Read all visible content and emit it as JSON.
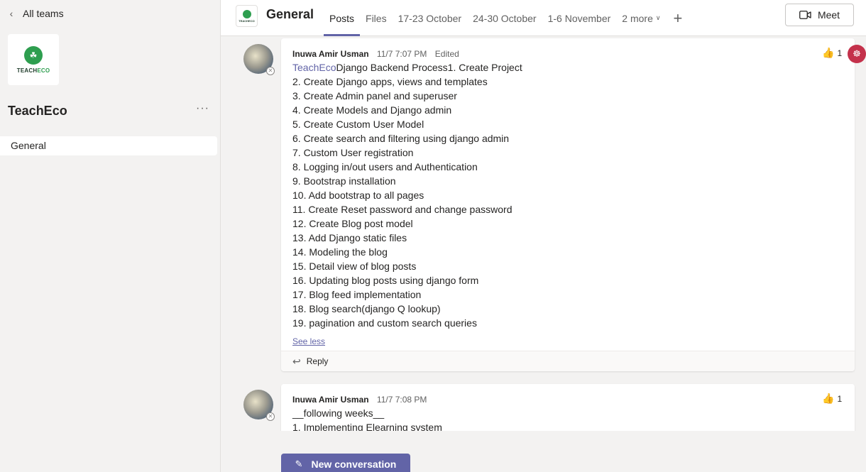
{
  "nav": {
    "back_label": "All teams",
    "back_icon": "chevron-left-icon"
  },
  "team": {
    "logo_text_1": "TEACH",
    "logo_text_2": "ECO",
    "name": "TeachEco",
    "more_label": "···",
    "channels": [
      {
        "label": "General",
        "selected": true
      }
    ]
  },
  "header": {
    "channel_icon_text": "TEACHECO",
    "channel_title": "General",
    "tabs": [
      {
        "label": "Posts",
        "active": true
      },
      {
        "label": "Files",
        "active": false
      },
      {
        "label": "17-23 October",
        "active": false
      },
      {
        "label": "24-30 October",
        "active": false
      },
      {
        "label": "1-6 November",
        "active": false
      }
    ],
    "more_tabs_label": "2 more",
    "add_tab_label": "+",
    "meet_label": "Meet"
  },
  "posts": [
    {
      "author": "Inuwa Amir Usman",
      "time": "11/7 7:07 PM",
      "edited": "Edited",
      "reaction_count": "1",
      "mention": "TeachEco",
      "lines": [
        "Django Backend Process1. Create Project",
        "2. Create Django apps, views and templates",
        "3. Create Admin panel and superuser",
        "4. Create Models and Django admin",
        "5. Create Custom User Model",
        "6. Create search and filtering using django admin",
        "7. Custom User registration",
        "8. Logging in/out users and Authentication",
        "9. Bootstrap installation",
        "10. Add bootstrap to all pages",
        "11. Create Reset password and change password",
        "12. Create Blog post model",
        "13. Add Django static files",
        "14. Modeling the blog",
        "15. Detail view of blog posts",
        "16. Updating blog posts using django form",
        "17. Blog feed implementation",
        "18. Blog search(django Q lookup)",
        "19. pagination and custom search queries"
      ],
      "see_less_label": "See less",
      "reply_label": "Reply"
    },
    {
      "author": "Inuwa Amir Usman",
      "time": "11/7 7:08 PM",
      "reaction_count": "1",
      "lines": [
        "__following weeks__",
        "1. Implementing Elearning system"
      ]
    }
  ],
  "new_conversation_label": "New conversation",
  "colors": {
    "accent": "#6264a7",
    "brand_green": "#2e9e4f",
    "badge_red": "#c4314b"
  }
}
